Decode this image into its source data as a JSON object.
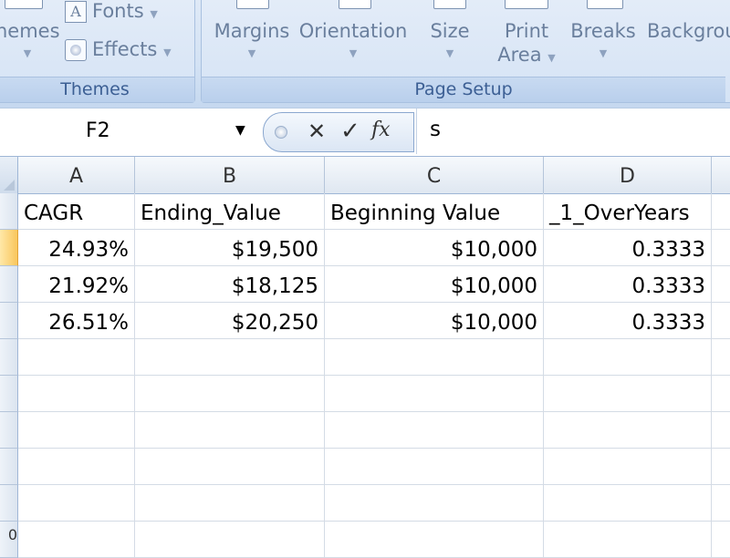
{
  "ribbon": {
    "themes_group": {
      "label": "Themes",
      "themes_button": "hemes",
      "fonts_button": "Fonts",
      "effects_button": "Effects"
    },
    "page_setup_group": {
      "label": "Page Setup",
      "margins": "Margins",
      "orientation": "Orientation",
      "size": "Size",
      "print_area_line1": "Print",
      "print_area_line2": "Area",
      "breaks": "Breaks",
      "background": "Backgrou"
    }
  },
  "formula_bar": {
    "name_box": "F2",
    "content": "s",
    "fx_label": "fx"
  },
  "sheet": {
    "columns": [
      "A",
      "B",
      "C",
      "D"
    ],
    "rows": [
      [
        "CAGR",
        "Ending_Value",
        "Beginning Value",
        "_1_OverYears"
      ],
      [
        "24.93%",
        "$19,500",
        "$10,000",
        "0.3333"
      ],
      [
        "21.92%",
        "$18,125",
        "$10,000",
        "0.3333"
      ],
      [
        "26.51%",
        "$20,250",
        "$10,000",
        "0.3333"
      ]
    ],
    "partial_row_number": "0"
  },
  "colors": {
    "ribbon_text": "#6a7f9d",
    "group_label_text": "#3c5f94",
    "active_row_header": "#f9c65c"
  }
}
